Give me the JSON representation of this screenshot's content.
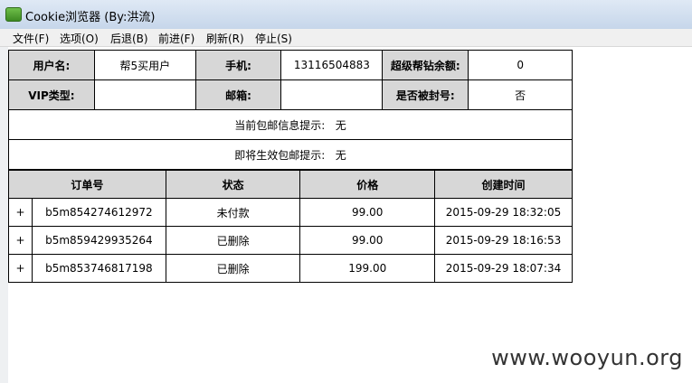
{
  "window": {
    "title": "Cookie浏览器 (By:洪流)"
  },
  "menu": [
    "文件(F)",
    "选项(O)",
    "后退(B)",
    "前进(F)",
    "刷新(R)",
    "停止(S)"
  ],
  "info": {
    "username_label": "用户名:",
    "username_value": "帮5买用户",
    "phone_label": "手机:",
    "phone_value": "13116504883",
    "balance_label": "超级帮钻余额:",
    "balance_value": "0",
    "vip_label": "VIP类型:",
    "vip_value": "",
    "email_label": "邮箱:",
    "email_value": "",
    "banned_label": "是否被封号:",
    "banned_value": "否",
    "current_tip": "当前包邮信息提示:   无",
    "upcoming_tip": "即将生效包邮提示:   无"
  },
  "orders": {
    "headers": [
      "订单号",
      "状态",
      "价格",
      "创建时间"
    ],
    "rows": [
      {
        "expand": "+",
        "order_no": "b5m854274612972",
        "status": "未付款",
        "price": "99.00",
        "created": "2015-09-29 18:32:05"
      },
      {
        "expand": "+",
        "order_no": "b5m859429935264",
        "status": "已删除",
        "price": "99.00",
        "created": "2015-09-29 18:16:53"
      },
      {
        "expand": "+",
        "order_no": "b5m853746817198",
        "status": "已删除",
        "price": "199.00",
        "created": "2015-09-29 18:07:34"
      }
    ]
  },
  "watermark": "www.wooyun.org"
}
